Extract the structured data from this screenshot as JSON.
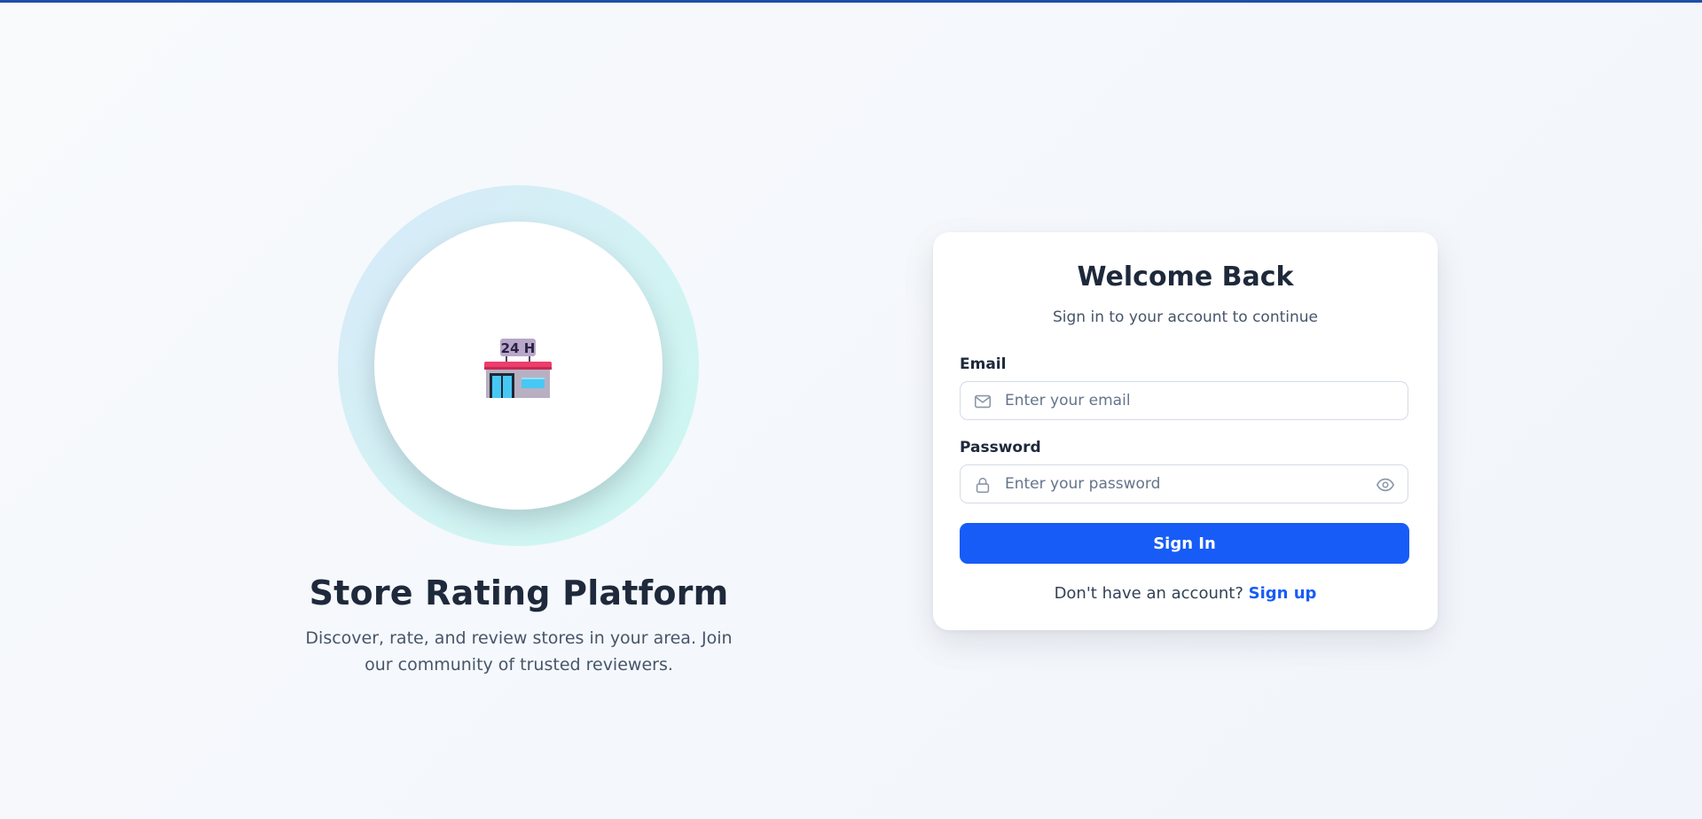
{
  "theme": {
    "accent": "#175cf7",
    "top_bar": "#1e4fa8",
    "heading": "#1e293b",
    "muted": "#475569"
  },
  "hero": {
    "icon": "convenience-store-24h-icon",
    "title": "Store Rating Platform",
    "description": "Discover, rate, and review stores in your area. Join our community of trusted reviewers."
  },
  "login": {
    "title": "Welcome Back",
    "subtitle": "Sign in to your account to continue",
    "email": {
      "label": "Email",
      "placeholder": "Enter your email",
      "value": "",
      "icon": "mail-icon"
    },
    "password": {
      "label": "Password",
      "placeholder": "Enter your password",
      "value": "",
      "icon": "lock-icon",
      "toggle_icon": "eye-icon"
    },
    "submit_label": "Sign In",
    "signup_prompt": "Don't have an account?",
    "signup_link": "Sign up"
  }
}
